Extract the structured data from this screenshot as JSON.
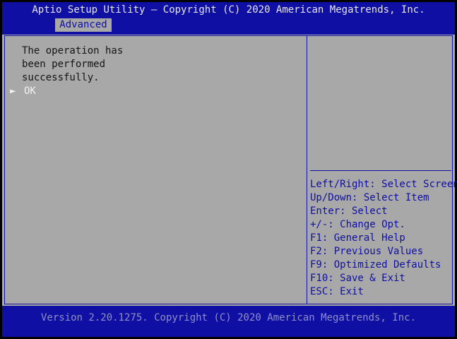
{
  "header": {
    "title": "Aptio Setup Utility – Copyright (C) 2020 American Megatrends, Inc.",
    "tabs": [
      {
        "label": "Advanced",
        "active": true
      }
    ]
  },
  "dialog": {
    "message_lines": [
      "The operation has",
      "been performed",
      "successfully."
    ],
    "options": [
      {
        "label": "OK",
        "selected": true,
        "marker": "►"
      }
    ]
  },
  "help": {
    "items": [
      "Left/Right: Select Screen",
      "Up/Down: Select Item",
      "Enter: Select",
      "+/-: Change Opt.",
      "F1: General Help",
      "F2: Previous Values",
      "F9: Optimized Defaults",
      "F10: Save & Exit",
      "ESC: Exit"
    ]
  },
  "footer": {
    "version": "Version 2.20.1275. Copyright (C) 2020 American Megatrends, Inc."
  },
  "colors": {
    "bios_blue": "#0f0fa3",
    "panel_grey": "#a8a8a8",
    "highlight_white": "#f2f2f2",
    "footer_text": "#8f8fc8"
  }
}
